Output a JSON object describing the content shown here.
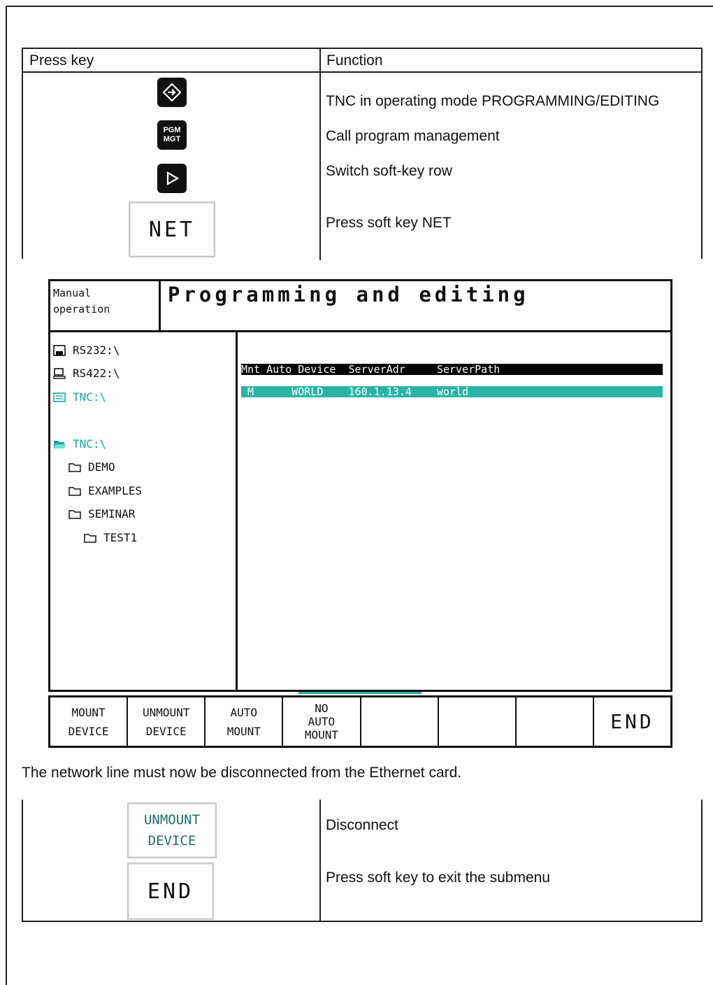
{
  "top_table": {
    "col_press_key": "Press key",
    "col_function": "Function",
    "rows": [
      {
        "key_icon": "programming-editing-key-icon",
        "function": "TNC in operating mode PROGRAMMING/EDITING"
      },
      {
        "key_icon": "pgm-mgt-key",
        "key_label_1": "PGM",
        "key_label_2": "MGT",
        "function": "Call program management"
      },
      {
        "key_icon": "soft-key-row-arrow-icon",
        "function": "Switch soft-key row"
      },
      {
        "softkey_label": "NET",
        "function": "Press soft key NET"
      }
    ]
  },
  "screen": {
    "mode_label": "Manual\noperation",
    "title": "Programming and editing",
    "drives": [
      {
        "icon": "floppy-icon",
        "label": "RS232:\\"
      },
      {
        "icon": "computer-icon",
        "label": "RS422:\\"
      },
      {
        "icon": "tnc-drive-icon",
        "label": "TNC:\\"
      }
    ],
    "tree_root": {
      "icon": "open-folder-icon",
      "label": "TNC:\\"
    },
    "folders": [
      {
        "label": "DEMO",
        "level": 1
      },
      {
        "label": "EXAMPLES",
        "level": 1
      },
      {
        "label": "SEMINAR",
        "level": 1
      },
      {
        "label": "TEST1",
        "level": 2
      }
    ],
    "grid_header": "Mnt Auto Device  ServerAdr     ServerPath",
    "grid_rows": [
      {
        "text": " M      WORLD    160.1.13.4    world"
      }
    ],
    "accent_color": "#2bb3a6"
  },
  "softkeys": [
    {
      "label": "MOUNT\nDEVICE"
    },
    {
      "label": "UNMOUNT\nDEVICE"
    },
    {
      "label": "AUTO\nMOUNT"
    },
    {
      "label": "NO\nAUTO\nMOUNT"
    },
    {
      "label": ""
    },
    {
      "label": ""
    },
    {
      "label": ""
    },
    {
      "label": "END"
    }
  ],
  "note": "The network line must now be disconnected from the Ethernet card.",
  "bottom_table": {
    "rows": [
      {
        "softkey_label_1": "UNMOUNT",
        "softkey_label_2": "DEVICE",
        "function": "Disconnect"
      },
      {
        "softkey_label": "END",
        "function": "Press soft key to exit the submenu"
      }
    ]
  }
}
